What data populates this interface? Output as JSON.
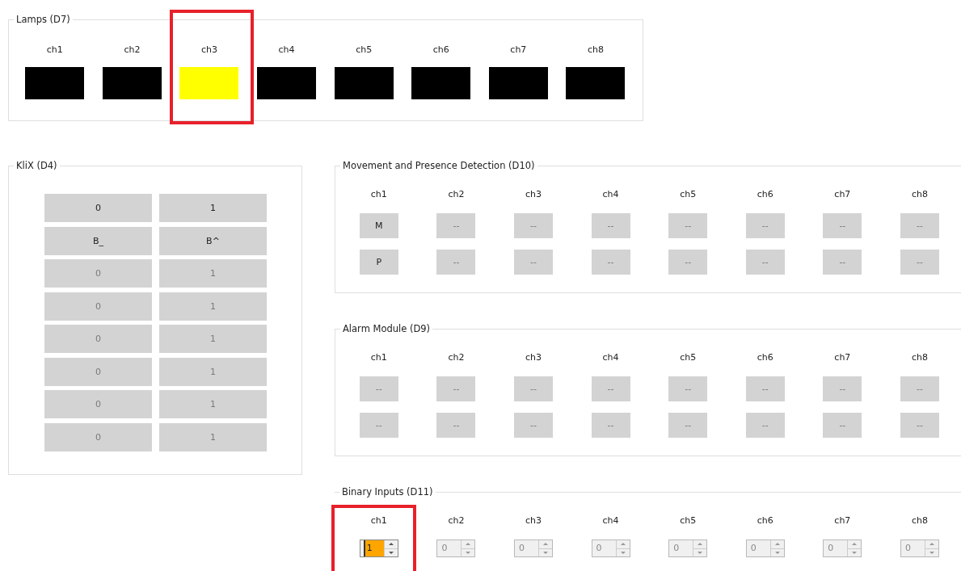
{
  "lamps": {
    "title": "Lamps (D7)",
    "channels": [
      {
        "label": "ch1",
        "on": false,
        "highlighted": false
      },
      {
        "label": "ch2",
        "on": false,
        "highlighted": false
      },
      {
        "label": "ch3",
        "on": true,
        "highlighted": true
      },
      {
        "label": "ch4",
        "on": false,
        "highlighted": false
      },
      {
        "label": "ch5",
        "on": false,
        "highlighted": false
      },
      {
        "label": "ch6",
        "on": false,
        "highlighted": false
      },
      {
        "label": "ch7",
        "on": false,
        "highlighted": false
      },
      {
        "label": "ch8",
        "on": false,
        "highlighted": false
      }
    ]
  },
  "klix": {
    "title": "KliX (D4)",
    "rows": [
      {
        "cells": [
          {
            "label": "0",
            "disabled": false
          },
          {
            "label": "1",
            "disabled": false
          }
        ]
      },
      {
        "cells": [
          {
            "label": "B_",
            "disabled": false
          },
          {
            "label": "B^",
            "disabled": false
          }
        ]
      },
      {
        "cells": [
          {
            "label": "0",
            "disabled": true
          },
          {
            "label": "1",
            "disabled": true
          }
        ]
      },
      {
        "cells": [
          {
            "label": "0",
            "disabled": true
          },
          {
            "label": "1",
            "disabled": true
          }
        ]
      },
      {
        "cells": [
          {
            "label": "0",
            "disabled": true
          },
          {
            "label": "1",
            "disabled": true
          }
        ]
      },
      {
        "cells": [
          {
            "label": "0",
            "disabled": true
          },
          {
            "label": "1",
            "disabled": true
          }
        ]
      },
      {
        "cells": [
          {
            "label": "0",
            "disabled": true
          },
          {
            "label": "1",
            "disabled": true
          }
        ]
      },
      {
        "cells": [
          {
            "label": "0",
            "disabled": true
          },
          {
            "label": "1",
            "disabled": true
          }
        ]
      }
    ]
  },
  "movement": {
    "title": "Movement and Presence Detection (D10)",
    "channels": [
      {
        "label": "ch1",
        "buttons": [
          {
            "label": "M",
            "disabled": false
          },
          {
            "label": "P",
            "disabled": false
          }
        ]
      },
      {
        "label": "ch2",
        "buttons": [
          {
            "label": "--",
            "disabled": true
          },
          {
            "label": "--",
            "disabled": true
          }
        ]
      },
      {
        "label": "ch3",
        "buttons": [
          {
            "label": "--",
            "disabled": true
          },
          {
            "label": "--",
            "disabled": true
          }
        ]
      },
      {
        "label": "ch4",
        "buttons": [
          {
            "label": "--",
            "disabled": true
          },
          {
            "label": "--",
            "disabled": true
          }
        ]
      },
      {
        "label": "ch5",
        "buttons": [
          {
            "label": "--",
            "disabled": true
          },
          {
            "label": "--",
            "disabled": true
          }
        ]
      },
      {
        "label": "ch6",
        "buttons": [
          {
            "label": "--",
            "disabled": true
          },
          {
            "label": "--",
            "disabled": true
          }
        ]
      },
      {
        "label": "ch7",
        "buttons": [
          {
            "label": "--",
            "disabled": true
          },
          {
            "label": "--",
            "disabled": true
          }
        ]
      },
      {
        "label": "ch8",
        "buttons": [
          {
            "label": "--",
            "disabled": true
          },
          {
            "label": "--",
            "disabled": true
          }
        ]
      }
    ]
  },
  "alarm": {
    "title": "Alarm Module (D9)",
    "channels": [
      {
        "label": "ch1",
        "buttons": [
          {
            "label": "--",
            "disabled": true
          },
          {
            "label": "--",
            "disabled": true
          }
        ]
      },
      {
        "label": "ch2",
        "buttons": [
          {
            "label": "--",
            "disabled": true
          },
          {
            "label": "--",
            "disabled": true
          }
        ]
      },
      {
        "label": "ch3",
        "buttons": [
          {
            "label": "--",
            "disabled": true
          },
          {
            "label": "--",
            "disabled": true
          }
        ]
      },
      {
        "label": "ch4",
        "buttons": [
          {
            "label": "--",
            "disabled": true
          },
          {
            "label": "--",
            "disabled": true
          }
        ]
      },
      {
        "label": "ch5",
        "buttons": [
          {
            "label": "--",
            "disabled": true
          },
          {
            "label": "--",
            "disabled": true
          }
        ]
      },
      {
        "label": "ch6",
        "buttons": [
          {
            "label": "--",
            "disabled": true
          },
          {
            "label": "--",
            "disabled": true
          }
        ]
      },
      {
        "label": "ch7",
        "buttons": [
          {
            "label": "--",
            "disabled": true
          },
          {
            "label": "--",
            "disabled": true
          }
        ]
      },
      {
        "label": "ch8",
        "buttons": [
          {
            "label": "--",
            "disabled": true
          },
          {
            "label": "--",
            "disabled": true
          }
        ]
      }
    ]
  },
  "binary": {
    "title": "Binary Inputs (D11)",
    "channels": [
      {
        "label": "ch1",
        "value": "1",
        "disabled": false,
        "focused": true,
        "highlighted": true
      },
      {
        "label": "ch2",
        "value": "0",
        "disabled": true,
        "focused": false,
        "highlighted": false
      },
      {
        "label": "ch3",
        "value": "0",
        "disabled": true,
        "focused": false,
        "highlighted": false
      },
      {
        "label": "ch4",
        "value": "0",
        "disabled": true,
        "focused": false,
        "highlighted": false
      },
      {
        "label": "ch5",
        "value": "0",
        "disabled": true,
        "focused": false,
        "highlighted": false
      },
      {
        "label": "ch6",
        "value": "0",
        "disabled": true,
        "focused": false,
        "highlighted": false
      },
      {
        "label": "ch7",
        "value": "0",
        "disabled": true,
        "focused": false,
        "highlighted": false
      },
      {
        "label": "ch8",
        "value": "0",
        "disabled": true,
        "focused": false,
        "highlighted": false
      }
    ]
  }
}
